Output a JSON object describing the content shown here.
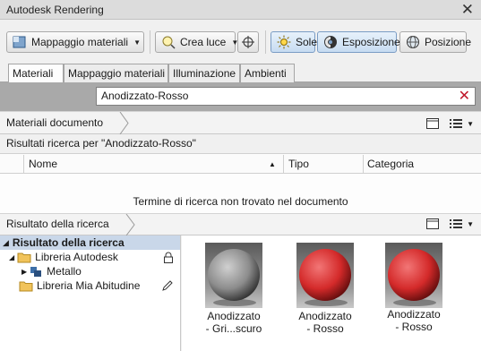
{
  "window": {
    "title": "Autodesk Rendering"
  },
  "toolbar": {
    "material_mapping_label": "Mappaggio materiali",
    "create_light_label": "Crea luce",
    "sun_label": "Sole",
    "exposure_label": "Esposizione",
    "position_label": "Posizione"
  },
  "tabs": [
    {
      "label": "Materiali",
      "active": true
    },
    {
      "label": "Mappaggio materiali",
      "active": false
    },
    {
      "label": "Illuminazione",
      "active": false
    },
    {
      "label": "Ambienti",
      "active": false
    }
  ],
  "search": {
    "value": "Anodizzato-Rosso"
  },
  "document": {
    "breadcrumb": "Materiali documento",
    "results_label": "Risultati ricerca per \"Anodizzato-Rosso\"",
    "columns": [
      "Nome",
      "Tipo",
      "Categoria"
    ],
    "empty_message": "Termine di ricerca non trovato nel documento"
  },
  "search_results": {
    "breadcrumb": "Risultato della ricerca",
    "tree": {
      "root": "Risultato della ricerca",
      "autodesk_library": "Libreria Autodesk",
      "metal": "Metallo",
      "my_library": "Libreria Mia Abitudine"
    },
    "materials": [
      {
        "name_line1": "Anodizzato",
        "name_line2": "- Gri...scuro",
        "color": "#8c8c8c"
      },
      {
        "name_line1": "Anodizzato",
        "name_line2": "- Rosso",
        "color": "#d42a2a"
      },
      {
        "name_line1": "Anodizzato",
        "name_line2": "- Rosso",
        "color": "#d42a2a"
      }
    ]
  },
  "colors": {
    "accent": "#c9d7e9",
    "clear_icon": "#c0172a",
    "search_band": "#a9a9a9"
  }
}
